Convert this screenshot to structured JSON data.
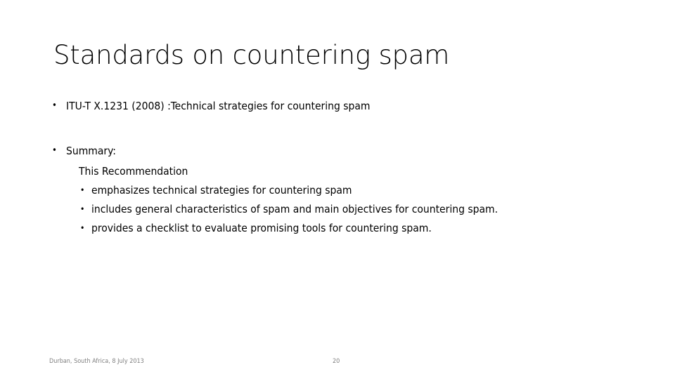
{
  "slide": {
    "title": "Standards on countering spam",
    "bullet_marker": "•",
    "sub_bullet_marker": "•",
    "content": {
      "standard_reference": "ITU-T X.1231 (2008) :Technical strategies for countering spam",
      "summary_label": "Summary:",
      "summary_intro": "This Recommendation",
      "summary_points": [
        "emphasizes technical strategies for countering spam",
        "includes general characteristics of spam and main objectives for countering spam.",
        "provides a checklist to evaluate promising tools for countering spam."
      ]
    },
    "footer": {
      "location_date": "Durban, South Africa, 8 July 2013",
      "page_number": "20"
    },
    "colors": {
      "background": "#ffffff",
      "text": "#000000",
      "footer_text": "#808080"
    }
  }
}
